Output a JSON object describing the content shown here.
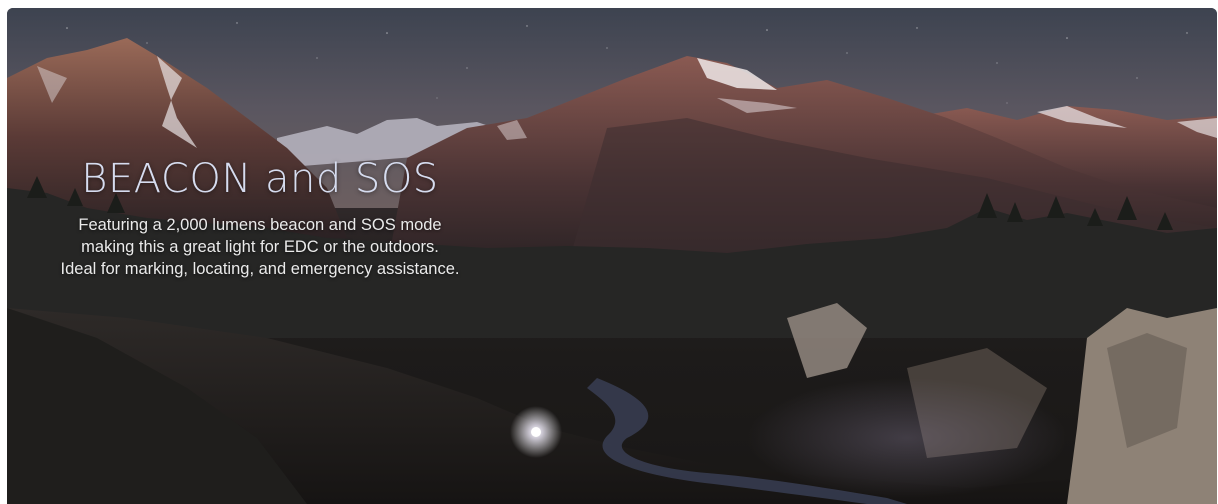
{
  "hero": {
    "title": "BEACON and SOS",
    "lines": [
      "Featuring a 2,000 lumens beacon and SOS mode",
      "making this a great light for EDC or the outdoors.",
      "Ideal for marking, locating, and emergency assistance."
    ],
    "image_subject": "night-mountain-landscape-with-beacon-light"
  },
  "colors": {
    "title": "#d6dcef",
    "text": "#eaeaea",
    "sky": "#4a4a52",
    "mountain": "#6b4a44",
    "beacon": "#ffffff"
  }
}
